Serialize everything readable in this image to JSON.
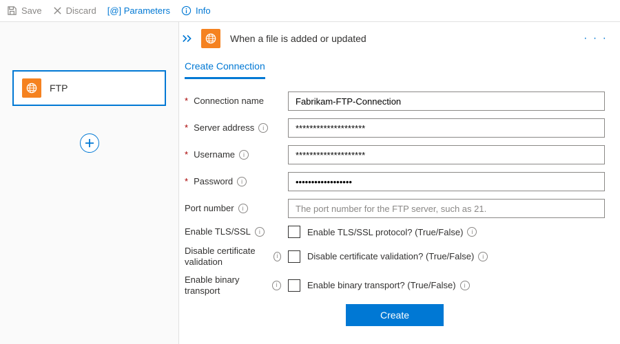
{
  "toolbar": {
    "save": "Save",
    "discard": "Discard",
    "parameters": "[@] Parameters",
    "info": "Info"
  },
  "left": {
    "ftp_label": "FTP"
  },
  "trigger": {
    "title": "When a file is added or updated"
  },
  "tabs": {
    "create_connection": "Create Connection"
  },
  "form": {
    "connection_name": {
      "label": "Connection name",
      "value": "Fabrikam-FTP-Connection"
    },
    "server_address": {
      "label": "Server address",
      "value": "********************"
    },
    "username": {
      "label": "Username",
      "value": "********************"
    },
    "password": {
      "label": "Password",
      "value": "••••••••••••••••••"
    },
    "port_number": {
      "label": "Port number",
      "placeholder": "The port number for the FTP server, such as 21."
    },
    "enable_tls": {
      "label": "Enable TLS/SSL",
      "check_label": "Enable TLS/SSL protocol? (True/False)"
    },
    "disable_cert": {
      "label": "Disable certificate validation",
      "check_label": "Disable certificate validation? (True/False)"
    },
    "enable_binary": {
      "label": "Enable binary transport",
      "check_label": "Enable binary transport? (True/False)"
    }
  },
  "buttons": {
    "create": "Create"
  }
}
